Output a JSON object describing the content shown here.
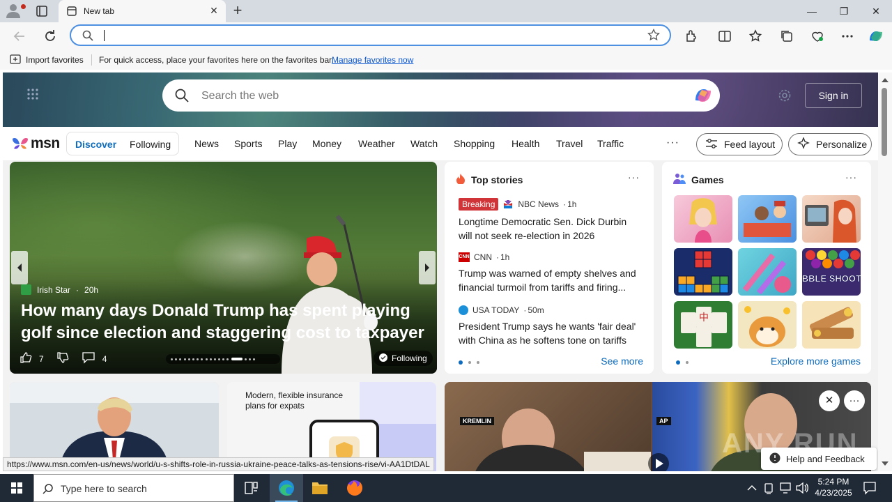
{
  "browser": {
    "tab_title": "New tab",
    "window_controls": {
      "minimize": "—",
      "restore": "❐",
      "close": "✕"
    },
    "address": {
      "value": "",
      "placeholder": ""
    }
  },
  "favorites_bar": {
    "import_label": "Import favorites",
    "message": "For quick access, place your favorites here on the favorites bar.",
    "manage_link": "Manage favorites now"
  },
  "msn": {
    "search_placeholder": "Search the web",
    "sign_in": "Sign in",
    "logo_text": "msn",
    "feed_tabs": [
      "Discover",
      "Following"
    ],
    "categories": [
      "News",
      "Sports",
      "Play",
      "Money",
      "Weather",
      "Watch",
      "Shopping",
      "Health",
      "Travel",
      "Traffic"
    ],
    "more": "···",
    "feed_layout": "Feed layout",
    "personalize": "Personalize"
  },
  "hero": {
    "source": "Irish Star",
    "age": "20h",
    "headline": "How many days Donald Trump has spent playing golf since election and staggering cost to taxpayer",
    "likes": "7",
    "comments": "4",
    "following": "Following",
    "slide_count": 18,
    "active_slide": 14
  },
  "top_stories": {
    "title": "Top stories",
    "more": "···",
    "items": [
      {
        "badge": "Breaking",
        "source": "NBC News",
        "age": "1h",
        "title": "Longtime Democratic Sen. Dick Durbin will not seek re-election in 2026"
      },
      {
        "badge": "",
        "source": "CNN",
        "age": "1h",
        "title": "Trump was warned of empty shelves and financial turmoil from tariffs and firing..."
      },
      {
        "badge": "",
        "source": "USA TODAY",
        "age": "50m",
        "title": "President Trump says he wants 'fair deal' with China as he softens tone on tariffs"
      }
    ],
    "see_more": "See more"
  },
  "games": {
    "title": "Games",
    "more": "···",
    "tile_text": "BUBBLE SHOOTER",
    "explore": "Explore more games"
  },
  "lower": {
    "ad_text": "Modern, flexible insurance plans for expats",
    "video_label_left": "KREMLIN",
    "video_label_right": "AP",
    "help": "Help and Feedback",
    "watermark": "ANY RUN"
  },
  "status_url": "https://www.msn.com/en-us/news/world/u-s-shifts-role-in-russia-ukraine-peace-talks-as-tensions-rise/vi-AA1DtDAL",
  "taskbar": {
    "search_placeholder": "Type here to search",
    "time": "5:24 PM",
    "date": "4/23/2025"
  },
  "colors": {
    "accent": "#0f6cbd",
    "breaking": "#d13438",
    "taskbar": "#1f2a36"
  }
}
